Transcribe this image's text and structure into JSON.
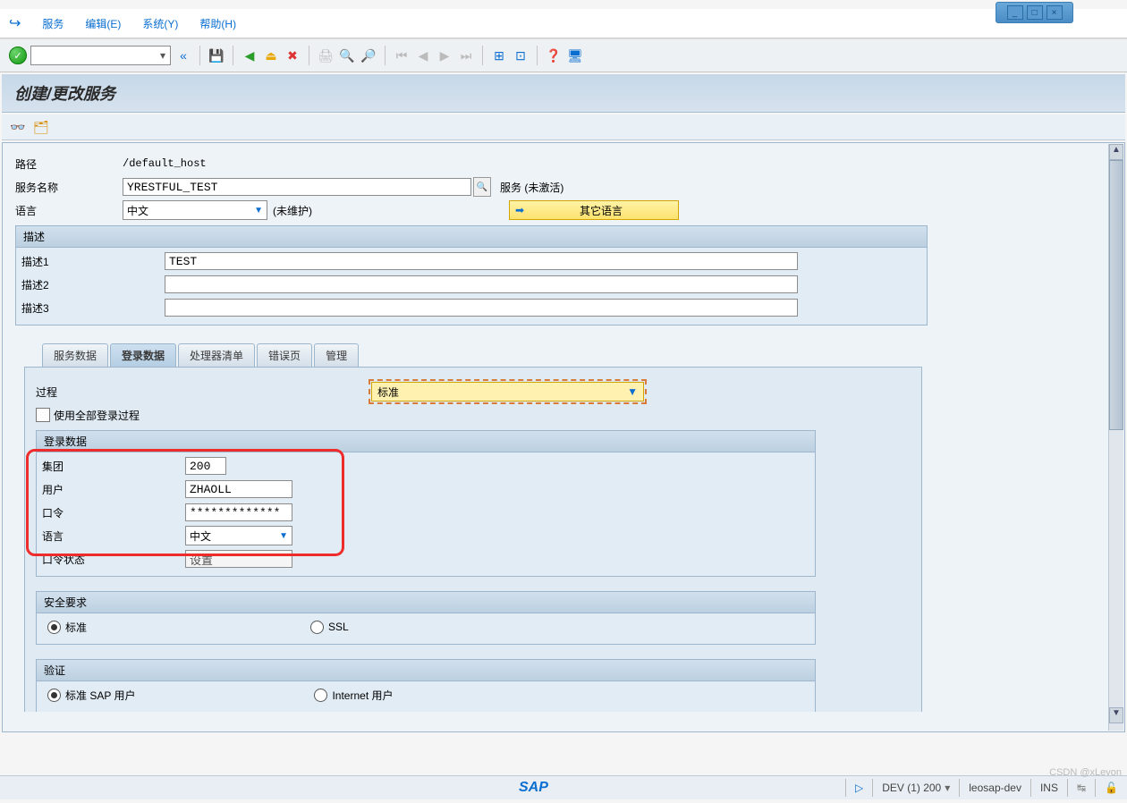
{
  "window": {
    "min": "_",
    "max": "□",
    "close": "×"
  },
  "menu": {
    "service": "服务",
    "edit": "编辑(E)",
    "system": "系统(Y)",
    "help": "帮助(H)"
  },
  "header": {
    "title": "创建/更改服务"
  },
  "fields": {
    "path_label": "路径",
    "path_value": "/default_host",
    "svcname_label": "服务名称",
    "svcname_value": "YRESTFUL_TEST",
    "svc_status": "服务 (未激活)",
    "lang_label": "语言",
    "lang_value": "中文",
    "lang_note": "(未维护)",
    "other_lang_btn": "其它语言"
  },
  "desc": {
    "group_title": "描述",
    "d1_label": "描述1",
    "d1_value": "TEST",
    "d2_label": "描述2",
    "d2_value": "",
    "d3_label": "描述3",
    "d3_value": ""
  },
  "tabs": {
    "t1": "服务数据",
    "t2": "登录数据",
    "t3": "处理器清单",
    "t4": "错误页",
    "t5": "管理"
  },
  "login": {
    "proc_label": "过程",
    "proc_value": "标准",
    "use_all_label": "使用全部登录过程",
    "group_title": "登录数据",
    "client_label": "集团",
    "client_value": "200",
    "user_label": "用户",
    "user_value": "ZHAOLL",
    "pw_label": "口令",
    "pw_value": "*************",
    "lang_label": "语言",
    "lang_value": "中文",
    "pwstate_label": "口令状态",
    "pwstate_value": "设置"
  },
  "security": {
    "group_title": "安全要求",
    "opt1": "标准",
    "opt2": "SSL"
  },
  "auth": {
    "group_title": "验证",
    "opt1": "标准 SAP 用户",
    "opt2": "Internet 用户"
  },
  "status": {
    "sap": "SAP",
    "system": "DEV (1) 200",
    "host": "leosap-dev",
    "ins": "INS"
  },
  "watermark": "CSDN @xLevon"
}
